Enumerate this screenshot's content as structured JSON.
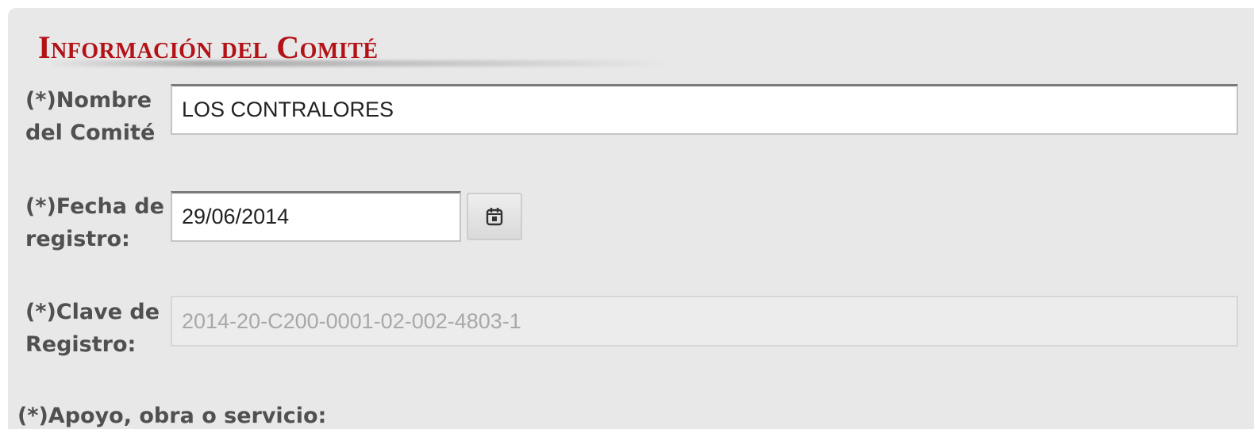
{
  "section": {
    "title": "Información del Comité"
  },
  "form": {
    "nombre": {
      "label": "(*)Nombre del Comité",
      "value": "LOS CONTRALORES"
    },
    "fecha": {
      "label": "(*)Fecha de registro:",
      "value": "29/06/2014",
      "button_icon": "calendar-icon"
    },
    "clave": {
      "label": "(*)Clave de Registro:",
      "value": "2014-20-C200-0001-02-002-4803-1",
      "disabled": true
    },
    "apoyo": {
      "label": "(*)Apoyo, obra o servicio:"
    }
  },
  "colors": {
    "panel_background": "#e8e8e8",
    "title": "#b31217",
    "label": "#505050",
    "input_disabled_text": "#a8a8a8"
  }
}
